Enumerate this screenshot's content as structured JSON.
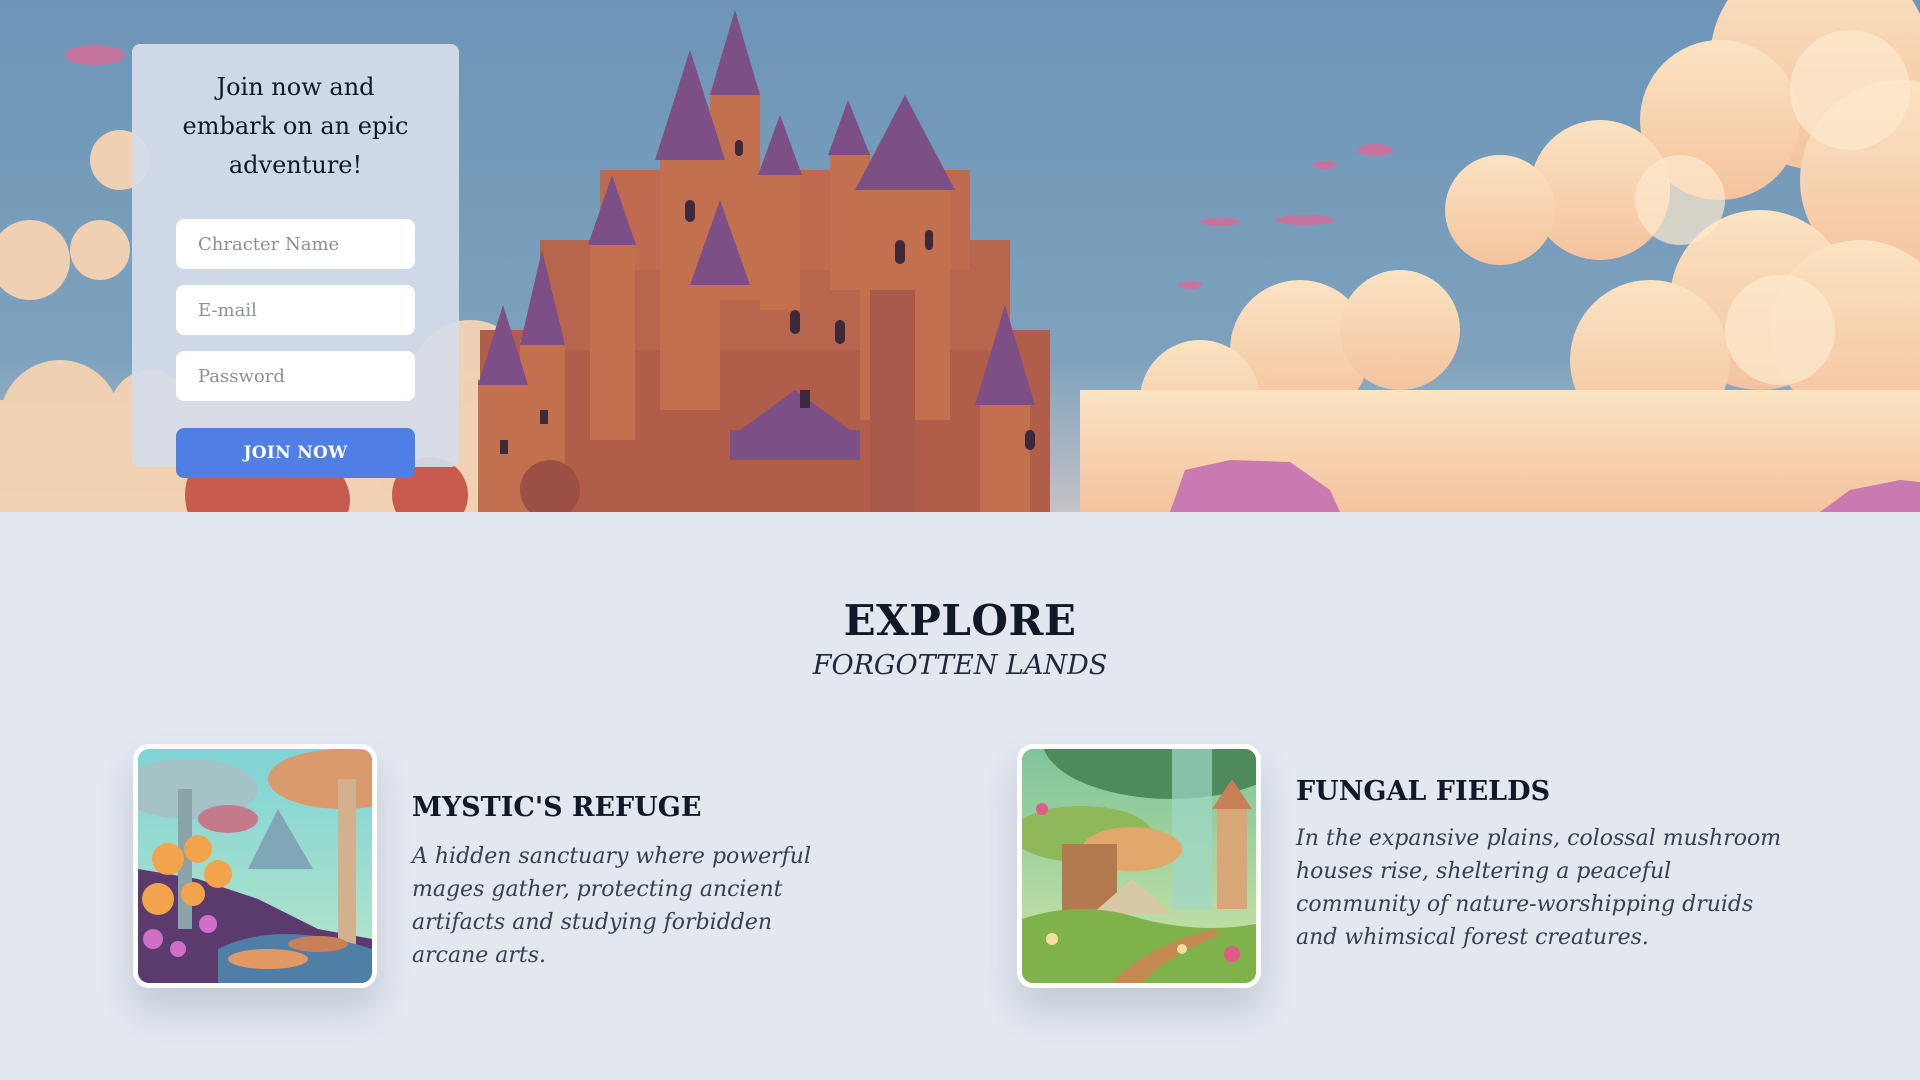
{
  "signup": {
    "title": "Join now and embark on an epic adventure!",
    "name_placeholder": "Chracter Name",
    "email_placeholder": "E-mail",
    "password_placeholder": "Password",
    "join_label": "JOIN NOW"
  },
  "explore": {
    "title": "EXPLORE",
    "subtitle": "FORGOTTEN LANDS",
    "places": [
      {
        "name": "MYSTIC'S REFUGE",
        "description": "A hidden sanctuary where powerful mages gather, protecting ancient artifacts and studying forbidden arcane arts."
      },
      {
        "name": "FUNGAL FIELDS",
        "description": "In the expansive plains, colossal mushroom houses rise, sheltering a peaceful community of nature-worshipping druids and whimsical forest creatures."
      }
    ]
  },
  "colors": {
    "accent": "#4f7fe4",
    "page_background": "#e2e7f0",
    "sky": "#6f97b8"
  }
}
